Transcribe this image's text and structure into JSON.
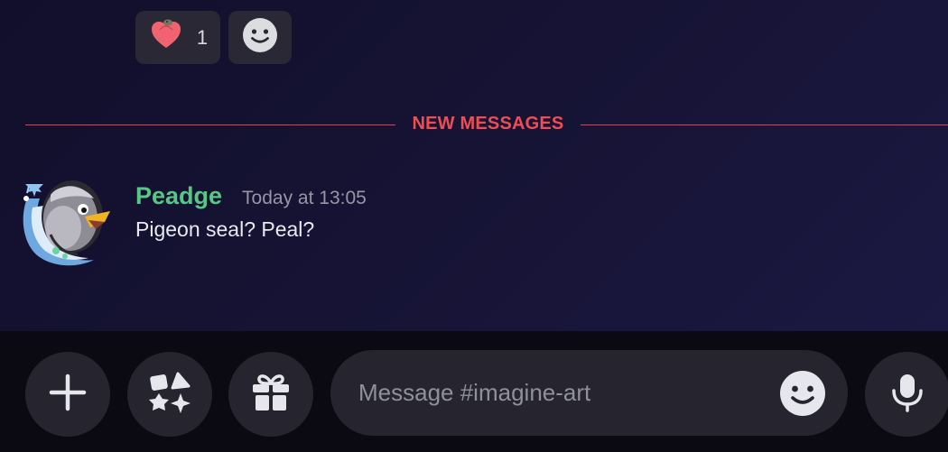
{
  "reactions": [
    {
      "icon": "heart-emoji-icon",
      "count": "1"
    },
    {
      "icon": "add-reaction-smiley-icon"
    }
  ],
  "divider": {
    "label": "NEW MESSAGES",
    "color": "#f04d52"
  },
  "message": {
    "username": "Peadge",
    "username_color": "#57c786",
    "timestamp": "Today at 13:05",
    "text": "Pigeon seal? Peal?"
  },
  "composer": {
    "placeholder": "Message #imagine-art",
    "buttons": [
      {
        "name": "plus-icon"
      },
      {
        "name": "apps-icon"
      },
      {
        "name": "gift-icon"
      },
      {
        "name": "emoji-icon"
      },
      {
        "name": "microphone-icon"
      }
    ]
  }
}
